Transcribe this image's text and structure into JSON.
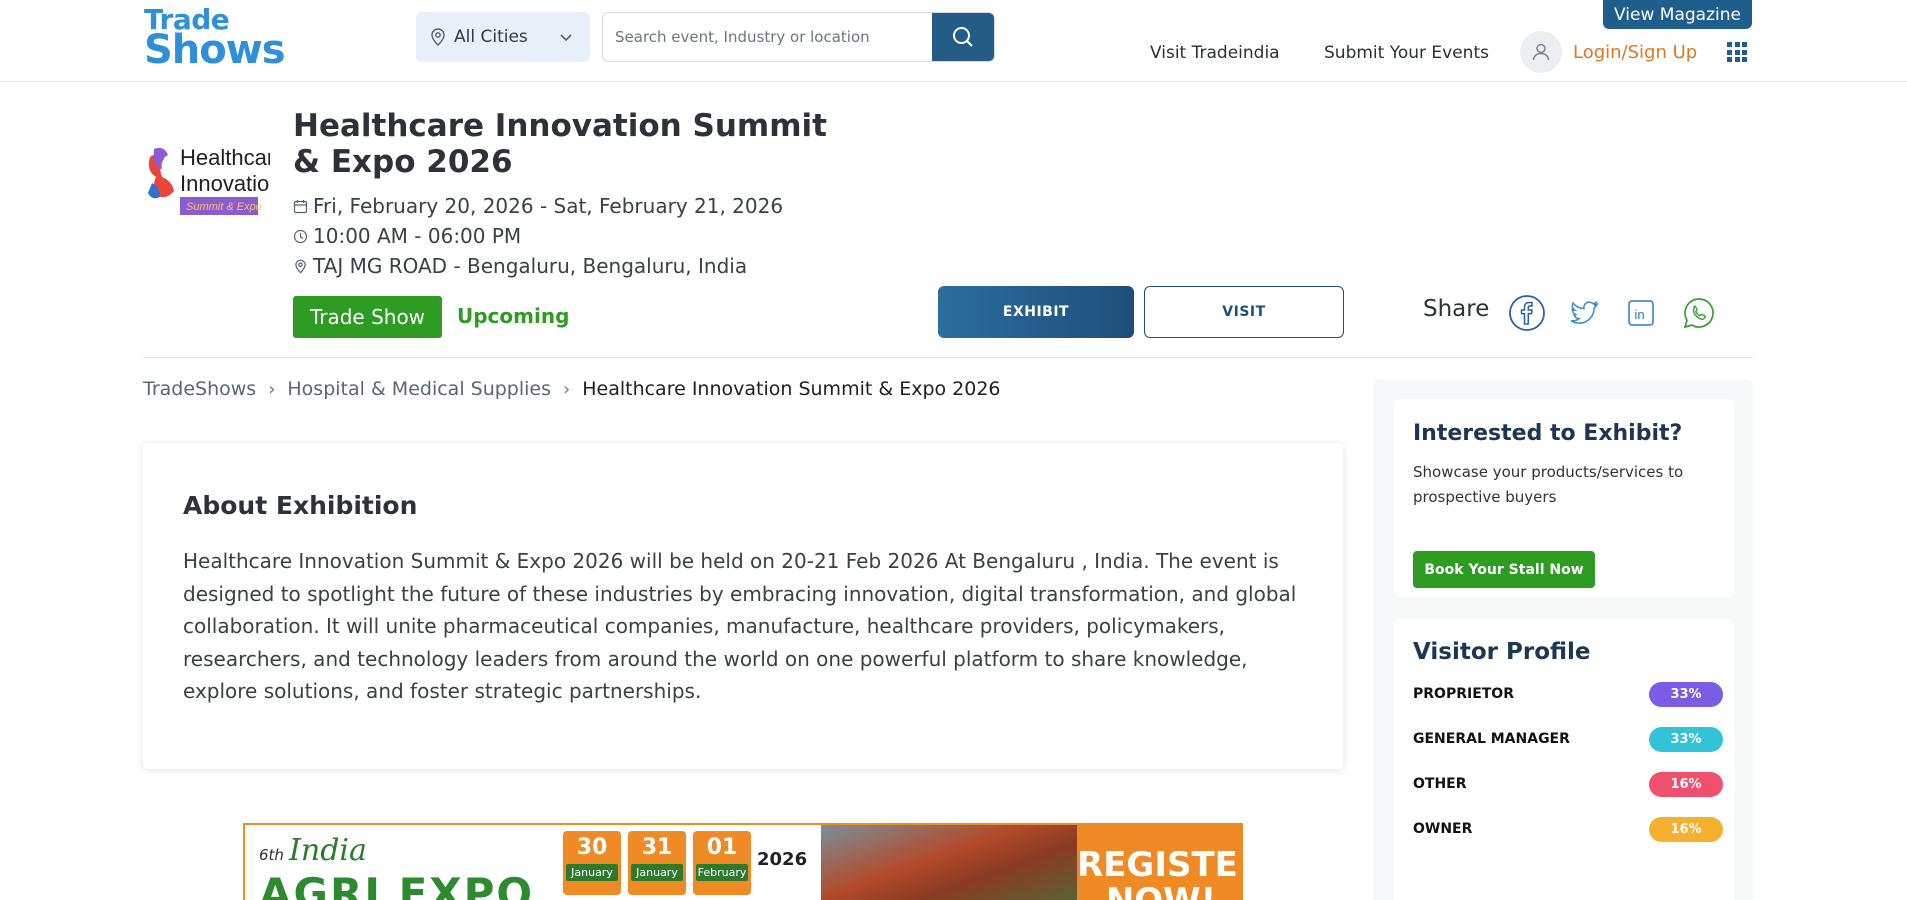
{
  "header": {
    "logo_line1": "Trade",
    "logo_line2": "Shows",
    "city_select": "All Cities",
    "search_placeholder": "Search event, Industry or location",
    "view_magazine": "View Magazine",
    "visit_tradeindia": "Visit Tradeindia",
    "submit_events": "Submit Your Events",
    "login": "Login/Sign Up"
  },
  "event": {
    "logo_text": [
      "Healthcare",
      "Innovation",
      "Summit & Expo"
    ],
    "title": "Healthcare Innovation Summit & Expo 2026",
    "date": "Fri, February 20, 2026 - Sat, February 21, 2026",
    "time": "10:00 AM - 06:00 PM",
    "venue": "TAJ MG ROAD - Bengaluru, Bengaluru, India",
    "type_tag": "Trade Show",
    "status": "Upcoming",
    "exhibit_button": "EXHIBIT",
    "visit_button": "VISIT",
    "share_label": "Share"
  },
  "breadcrumb": {
    "items": [
      "TradeShows",
      "Hospital & Medical Supplies"
    ],
    "current": "Healthcare Innovation Summit & Expo 2026"
  },
  "about": {
    "heading": "About Exhibition",
    "text": "Healthcare Innovation Summit & Expo 2026 will be held on 20-21 Feb 2026 At Bengaluru , India. The event is designed to spotlight the future of these industries by embracing innovation, digital transformation, and global collaboration. It will unite pharmaceutical companies, manufacture, healthcare providers, policymakers, researchers, and technology leaders from around the world on one powerful platform to share knowledge, explore solutions, and foster strategic partnerships."
  },
  "banner": {
    "edition": "6th",
    "india": "India",
    "agri_expo": "AGRI EXPO",
    "dates": [
      {
        "day": "30",
        "month": "January"
      },
      {
        "day": "31",
        "month": "January"
      },
      {
        "day": "01",
        "month": "February"
      }
    ],
    "year": "2026",
    "register": "REGISTER NOW!"
  },
  "sidebar": {
    "exhibit_card": {
      "heading": "Interested to Exhibit?",
      "text": "Showcase your products/services to prospective buyers",
      "button": "Book Your Stall Now"
    },
    "visitor_profile": {
      "heading": "Visitor Profile",
      "rows": [
        {
          "label": "PROPRIETOR",
          "value": "33%",
          "color": "#7b5ce6"
        },
        {
          "label": "GENERAL MANAGER",
          "value": "33%",
          "color": "#33c3d8"
        },
        {
          "label": "OTHER",
          "value": "16%",
          "color": "#f0506e"
        },
        {
          "label": "OWNER",
          "value": "16%",
          "color": "#f5b02e"
        }
      ]
    }
  },
  "colors": {
    "brand_blue": "#2f8fd8",
    "primary_dark": "#1e5d8c",
    "green": "#2e9c23",
    "orange": "#e0771f"
  }
}
